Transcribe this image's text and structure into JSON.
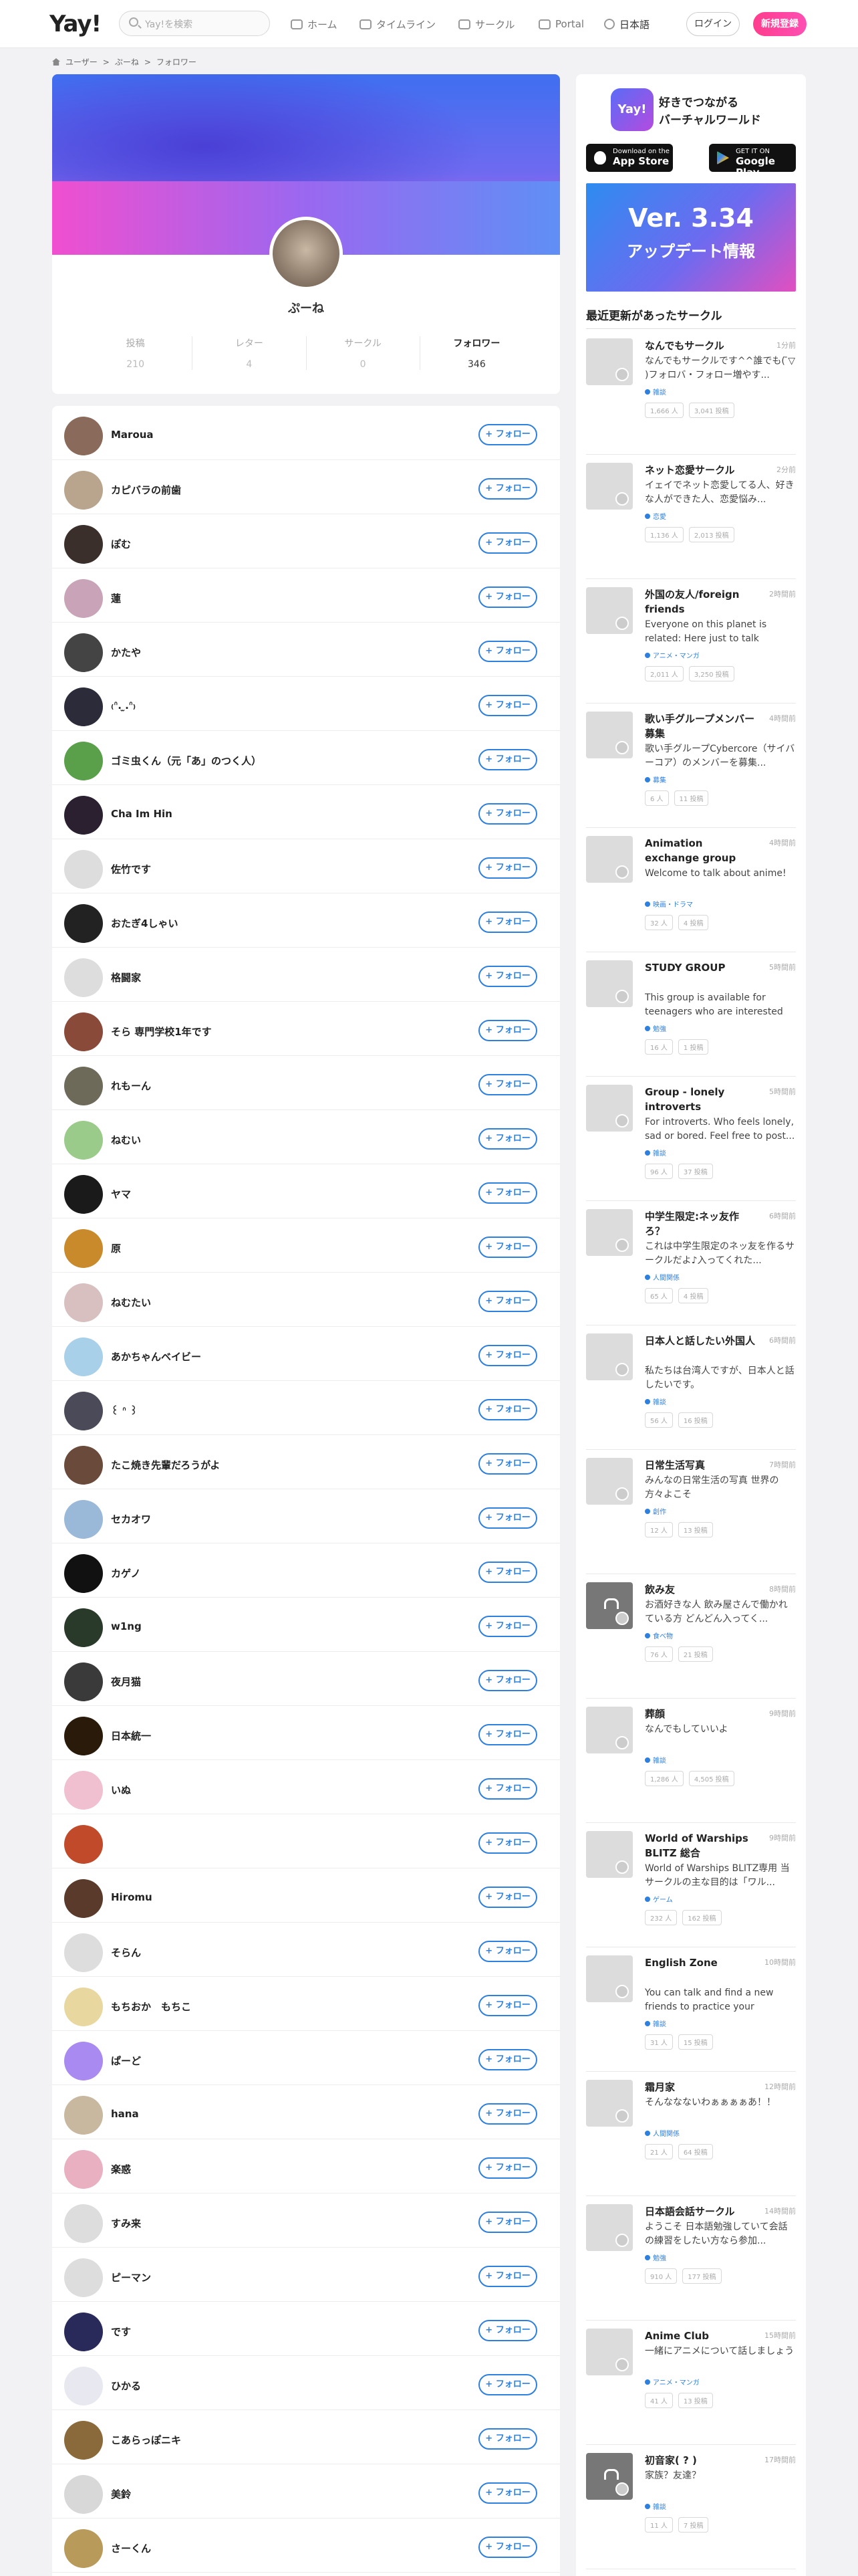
{
  "header": {
    "logo": "Yay!",
    "search_placeholder": "Yay!を検索",
    "nav": [
      {
        "label": "ホーム",
        "icon": "home-icon"
      },
      {
        "label": "タイムライン",
        "icon": "timeline-icon"
      },
      {
        "label": "サークル",
        "icon": "circle-icon"
      },
      {
        "label": "Portal",
        "icon": "portal-icon"
      },
      {
        "label": "日本語",
        "icon": "globe-icon"
      }
    ],
    "login": "ログイン",
    "register": "新規登録"
  },
  "breadcrumb": [
    "ユーザー",
    ">",
    "ぷーね",
    ">",
    "フォロワー"
  ],
  "profile": {
    "name": "ぷーね",
    "stats": [
      {
        "label": "投稿",
        "value": "210"
      },
      {
        "label": "レター",
        "value": "4"
      },
      {
        "label": "サークル",
        "value": "0"
      },
      {
        "label": "フォロワー",
        "value": "346"
      }
    ]
  },
  "follow_label": "+ フォロー",
  "followers": [
    {
      "name": "Maroua",
      "color": "#8a6a5a"
    },
    {
      "name": "カピバラの前歯",
      "color": "#b9a58e"
    },
    {
      "name": "ぽむ",
      "color": "#3a2f2a"
    },
    {
      "name": "蓮",
      "color": "#c9a4b8"
    },
    {
      "name": "かたや",
      "color": "#444444"
    },
    {
      "name": "₍ᐢ. ̫.ᐢ₎",
      "color": "#2b2b3a"
    },
    {
      "name": "ゴミ虫くん（元「あ」のつく人）",
      "color": "#5aa04a"
    },
    {
      "name": "Cha Im Hin",
      "color": "#2a2030"
    },
    {
      "name": "佐竹です",
      "color": "#dddddd"
    },
    {
      "name": "おたぎ4しゃい",
      "color": "#222222"
    },
    {
      "name": "格闘家",
      "color": "#dddddd"
    },
    {
      "name": "そら 専門学校1年です",
      "color": "#8a4a3a"
    },
    {
      "name": "れもーん",
      "color": "#6e6a5a"
    },
    {
      "name": "ねむい",
      "color": "#9acb8a"
    },
    {
      "name": "ヤマ",
      "color": "#1a1a1a"
    },
    {
      "name": "原",
      "color": "#c88a2a"
    },
    {
      "name": "ねむたい",
      "color": "#d8c0c0"
    },
    {
      "name": "あかちゃんベイビー",
      "color": "#a8d0e8"
    },
    {
      "name": "꒰ ᐢ ꒱",
      "color": "#4a4a58"
    },
    {
      "name": "たこ焼き先輩だろうがよ",
      "color": "#6a4a3a"
    },
    {
      "name": "セカオワ",
      "color": "#9ab8d8"
    },
    {
      "name": "カゲノ",
      "color": "#111111"
    },
    {
      "name": "w1ng",
      "color": "#2a3a2a"
    },
    {
      "name": "夜月猫",
      "color": "#3a3a3a"
    },
    {
      "name": "日本統一",
      "color": "#2a1a0a"
    },
    {
      "name": "いぬ",
      "color": "#f0c0d0"
    },
    {
      "name": "",
      "color": "#c04a2a"
    },
    {
      "name": "Hiromu",
      "color": "#5a3a2a"
    },
    {
      "name": "そらん",
      "color": "#dddddd"
    },
    {
      "name": "もちおか　もちこ",
      "color": "#e8d8a0"
    },
    {
      "name": "ぱーど",
      "color": "#a88af0"
    },
    {
      "name": "hana",
      "color": "#c8b8a0"
    },
    {
      "name": "楽惑",
      "color": "#e8b0c0"
    },
    {
      "name": "すみ来",
      "color": "#dddddd"
    },
    {
      "name": "ピーマン",
      "color": "#dddddd"
    },
    {
      "name": "です",
      "color": "#2a2a5a"
    },
    {
      "name": "ひかる",
      "color": "#e8e8f0"
    },
    {
      "name": "こあらっぽニキ",
      "color": "#8a6a3a"
    },
    {
      "name": "美鈴",
      "color": "#d8d8d8"
    },
    {
      "name": "さーくん",
      "color": "#b89a5a"
    }
  ],
  "sidebar": {
    "promo_title_1": "好きでつながる",
    "promo_title_2": "バーチャルワールド",
    "app_icon_text": "Yay!",
    "appstore_top": "Download on the",
    "appstore": "App Store",
    "gplay_top": "GET IT ON",
    "gplay": "Google Play",
    "banner_1": "Ver. 3.34",
    "banner_2": "アップデート情報",
    "section_title": "最近更新があったサークル",
    "circles": [
      {
        "title": "なんでもサークル",
        "time": "1分前",
        "desc": "なんでもサークルです^^誰でも( ̄▽ ̄)フォロバ・フォロー増やす...",
        "cat": "雑談",
        "members": "1,666 人",
        "posts": "3,041 投稿",
        "dark": false
      },
      {
        "title": "ネット恋愛サークル",
        "time": "2分前",
        "desc": "イェイでネット恋愛してる人、好きな人ができた人、恋愛悩み...",
        "cat": "恋愛",
        "members": "1,136 人",
        "posts": "2,013 投稿",
        "dark": false
      },
      {
        "title": "外国の友人/foreign friends",
        "time": "2時間前",
        "desc": "Everyone on this planet is related: Here just to talk about...",
        "cat": "アニメ・マンガ",
        "members": "2,011 人",
        "posts": "3,250 投稿",
        "dark": false
      },
      {
        "title": "歌い手グループメンバー募集",
        "time": "4時間前",
        "desc": "歌い手グループCybercore（サイバーコア）のメンバーを募集...",
        "cat": "募集",
        "members": "6 人",
        "posts": "11 投稿",
        "dark": false
      },
      {
        "title": "Animation exchange group",
        "time": "4時間前",
        "desc": "Welcome to talk about anime!",
        "cat": "映画・ドラマ",
        "members": "32 人",
        "posts": "4 投稿",
        "dark": false
      },
      {
        "title": "STUDY GROUP",
        "time": "5時間前",
        "desc": "This group is available for teenagers who are interested in...",
        "cat": "勉強",
        "members": "16 人",
        "posts": "1 投稿",
        "dark": false
      },
      {
        "title": "Group - lonely introverts",
        "time": "5時間前",
        "desc": "For introverts. Who feels lonely, sad or bored. Feel free to post...",
        "cat": "雑談",
        "members": "96 人",
        "posts": "37 投稿",
        "dark": false
      },
      {
        "title": "中学生限定:ネッ友作ろ？",
        "time": "6時間前",
        "desc": "これは中学生限定のネッ友を作るサークルだよ♪入ってくれた...",
        "cat": "人間関係",
        "members": "65 人",
        "posts": "4 投稿",
        "dark": false
      },
      {
        "title": "日本人と話したい外国人",
        "time": "6時間前",
        "desc": "私たちは台湾人ですが、日本人と話したいです。",
        "cat": "雑談",
        "members": "56 人",
        "posts": "16 投稿",
        "dark": false
      },
      {
        "title": "日常生活写真",
        "time": "7時間前",
        "desc": "みんなの日常生活の写真 世界の方々よこそ",
        "cat": "創作",
        "members": "12 人",
        "posts": "13 投稿",
        "dark": false
      },
      {
        "title": "飲み友",
        "time": "8時間前",
        "desc": "お酒好きな人 飲み屋さんで働かれている方 どんどん入ってく...",
        "cat": "食べ物",
        "members": "76 人",
        "posts": "21 投稿",
        "dark": true
      },
      {
        "title": "葬顔",
        "time": "9時間前",
        "desc": "なんでもしていいよ",
        "cat": "雑談",
        "members": "1,286 人",
        "posts": "4,505 投稿",
        "dark": false
      },
      {
        "title": "World of Warships BLITZ 総合",
        "time": "9時間前",
        "desc": "World of Warships BLITZ専用 当サークルの主な目的は「ワル...",
        "cat": "ゲーム",
        "members": "232 人",
        "posts": "162 投稿",
        "dark": false
      },
      {
        "title": "English Zone",
        "time": "10時間前",
        "desc": "You can talk and find a new friends to practice your English...",
        "cat": "雑談",
        "members": "31 人",
        "posts": "15 投稿",
        "dark": false
      },
      {
        "title": "霜月家",
        "time": "12時間前",
        "desc": "そんななないわぁぁぁぁあ！！",
        "cat": "人間関係",
        "members": "21 人",
        "posts": "64 投稿",
        "dark": false
      },
      {
        "title": "日本語会話サークル",
        "time": "14時間前",
        "desc": "ようこそ 日本語勉強していて会話の練習をしたい方なら参加...",
        "cat": "勉強",
        "members": "910 人",
        "posts": "177 投稿",
        "dark": false
      },
      {
        "title": "Anime Club",
        "time": "15時間前",
        "desc": "一緒にアニメについて話しましょう",
        "cat": "アニメ・マンガ",
        "members": "41 人",
        "posts": "13 投稿",
        "dark": false
      },
      {
        "title": "初音家( ? )",
        "time": "17時間前",
        "desc": "家族？友達？",
        "cat": "雑談",
        "members": "11 人",
        "posts": "7 投稿",
        "dark": true
      }
    ]
  }
}
